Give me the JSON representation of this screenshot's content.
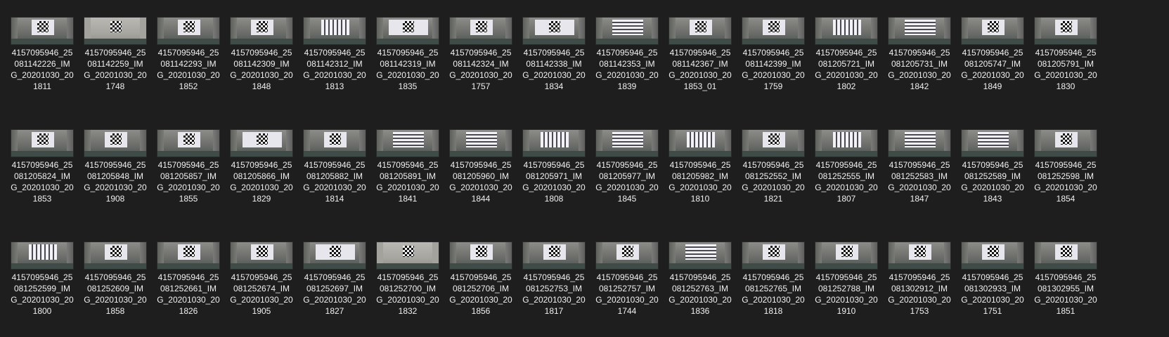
{
  "files": [
    {
      "line1": "4157095946_25",
      "line2": "081142226_IM",
      "line3": "G_20201030_20",
      "line4": "1811",
      "thumb": "checker"
    },
    {
      "line1": "4157095946_25",
      "line2": "081142259_IM",
      "line3": "G_20201030_20",
      "line4": "1748",
      "thumb": "bright"
    },
    {
      "line1": "4157095946_25",
      "line2": "081142293_IM",
      "line3": "G_20201030_20",
      "line4": "1852",
      "thumb": "checker"
    },
    {
      "line1": "4157095946_25",
      "line2": "081142309_IM",
      "line3": "G_20201030_20",
      "line4": "1848",
      "thumb": "checker"
    },
    {
      "line1": "4157095946_25",
      "line2": "081142312_IM",
      "line3": "G_20201030_20",
      "line4": "1813",
      "thumb": "stripes-v"
    },
    {
      "line1": "4157095946_25",
      "line2": "081142319_IM",
      "line3": "G_20201030_20",
      "line4": "1835",
      "thumb": "wide"
    },
    {
      "line1": "4157095946_25",
      "line2": "081142324_IM",
      "line3": "G_20201030_20",
      "line4": "1757",
      "thumb": "checker"
    },
    {
      "line1": "4157095946_25",
      "line2": "081142338_IM",
      "line3": "G_20201030_20",
      "line4": "1834",
      "thumb": "wide"
    },
    {
      "line1": "4157095946_25",
      "line2": "081142353_IM",
      "line3": "G_20201030_20",
      "line4": "1839",
      "thumb": "stripes-h"
    },
    {
      "line1": "4157095946_25",
      "line2": "081142367_IM",
      "line3": "G_20201030_20",
      "line4": "1853_01",
      "thumb": "checker"
    },
    {
      "line1": "4157095946_25",
      "line2": "081142399_IM",
      "line3": "G_20201030_20",
      "line4": "1759",
      "thumb": "checker"
    },
    {
      "line1": "4157095946_25",
      "line2": "081205721_IM",
      "line3": "G_20201030_20",
      "line4": "1802",
      "thumb": "stripes-v"
    },
    {
      "line1": "4157095946_25",
      "line2": "081205731_IM",
      "line3": "G_20201030_20",
      "line4": "1842",
      "thumb": "stripes-h"
    },
    {
      "line1": "4157095946_25",
      "line2": "081205747_IM",
      "line3": "G_20201030_20",
      "line4": "1849",
      "thumb": "checker"
    },
    {
      "line1": "4157095946_25",
      "line2": "081205791_IM",
      "line3": "G_20201030_20",
      "line4": "1830",
      "thumb": "checker"
    },
    {
      "line1": "4157095946_25",
      "line2": "081205824_IM",
      "line3": "G_20201030_20",
      "line4": "1853",
      "thumb": "checker"
    },
    {
      "line1": "4157095946_25",
      "line2": "081205848_IM",
      "line3": "G_20201030_20",
      "line4": "1908",
      "thumb": "checker"
    },
    {
      "line1": "4157095946_25",
      "line2": "081205857_IM",
      "line3": "G_20201030_20",
      "line4": "1855",
      "thumb": "checker"
    },
    {
      "line1": "4157095946_25",
      "line2": "081205866_IM",
      "line3": "G_20201030_20",
      "line4": "1829",
      "thumb": "wide"
    },
    {
      "line1": "4157095946_25",
      "line2": "081205882_IM",
      "line3": "G_20201030_20",
      "line4": "1814",
      "thumb": "checker"
    },
    {
      "line1": "4157095946_25",
      "line2": "081205891_IM",
      "line3": "G_20201030_20",
      "line4": "1841",
      "thumb": "stripes-h"
    },
    {
      "line1": "4157095946_25",
      "line2": "081205960_IM",
      "line3": "G_20201030_20",
      "line4": "1844",
      "thumb": "stripes-h"
    },
    {
      "line1": "4157095946_25",
      "line2": "081205971_IM",
      "line3": "G_20201030_20",
      "line4": "1808",
      "thumb": "stripes-v"
    },
    {
      "line1": "4157095946_25",
      "line2": "081205977_IM",
      "line3": "G_20201030_20",
      "line4": "1845",
      "thumb": "stripes-h"
    },
    {
      "line1": "4157095946_25",
      "line2": "081205982_IM",
      "line3": "G_20201030_20",
      "line4": "1810",
      "thumb": "stripes-v"
    },
    {
      "line1": "4157095946_25",
      "line2": "081252552_IM",
      "line3": "G_20201030_20",
      "line4": "1821",
      "thumb": "checker"
    },
    {
      "line1": "4157095946_25",
      "line2": "081252555_IM",
      "line3": "G_20201030_20",
      "line4": "1807",
      "thumb": "stripes-v"
    },
    {
      "line1": "4157095946_25",
      "line2": "081252583_IM",
      "line3": "G_20201030_20",
      "line4": "1847",
      "thumb": "stripes-h"
    },
    {
      "line1": "4157095946_25",
      "line2": "081252589_IM",
      "line3": "G_20201030_20",
      "line4": "1843",
      "thumb": "stripes-h"
    },
    {
      "line1": "4157095946_25",
      "line2": "081252598_IM",
      "line3": "G_20201030_20",
      "line4": "1854",
      "thumb": "checker"
    },
    {
      "line1": "4157095946_25",
      "line2": "081252599_IM",
      "line3": "G_20201030_20",
      "line4": "1800",
      "thumb": "stripes-v"
    },
    {
      "line1": "4157095946_25",
      "line2": "081252609_IM",
      "line3": "G_20201030_20",
      "line4": "1858",
      "thumb": "checker"
    },
    {
      "line1": "4157095946_25",
      "line2": "081252661_IM",
      "line3": "G_20201030_20",
      "line4": "1826",
      "thumb": "checker"
    },
    {
      "line1": "4157095946_25",
      "line2": "081252674_IM",
      "line3": "G_20201030_20",
      "line4": "1905",
      "thumb": "checker"
    },
    {
      "line1": "4157095946_25",
      "line2": "081252697_IM",
      "line3": "G_20201030_20",
      "line4": "1827",
      "thumb": "wide"
    },
    {
      "line1": "4157095946_25",
      "line2": "081252700_IM",
      "line3": "G_20201030_20",
      "line4": "1832",
      "thumb": "bright"
    },
    {
      "line1": "4157095946_25",
      "line2": "081252706_IM",
      "line3": "G_20201030_20",
      "line4": "1856",
      "thumb": "checker"
    },
    {
      "line1": "4157095946_25",
      "line2": "081252753_IM",
      "line3": "G_20201030_20",
      "line4": "1817",
      "thumb": "checker"
    },
    {
      "line1": "4157095946_25",
      "line2": "081252757_IM",
      "line3": "G_20201030_20",
      "line4": "1744",
      "thumb": "checker"
    },
    {
      "line1": "4157095946_25",
      "line2": "081252763_IM",
      "line3": "G_20201030_20",
      "line4": "1836",
      "thumb": "stripes-h"
    },
    {
      "line1": "4157095946_25",
      "line2": "081252765_IM",
      "line3": "G_20201030_20",
      "line4": "1818",
      "thumb": "checker"
    },
    {
      "line1": "4157095946_25",
      "line2": "081252788_IM",
      "line3": "G_20201030_20",
      "line4": "1910",
      "thumb": "checker"
    },
    {
      "line1": "4157095946_25",
      "line2": "081302912_IM",
      "line3": "G_20201030_20",
      "line4": "1753",
      "thumb": "checker"
    },
    {
      "line1": "4157095946_25",
      "line2": "081302933_IM",
      "line3": "G_20201030_20",
      "line4": "1751",
      "thumb": "checker"
    },
    {
      "line1": "4157095946_25",
      "line2": "081302955_IM",
      "line3": "G_20201030_20",
      "line4": "1851",
      "thumb": "checker"
    }
  ]
}
